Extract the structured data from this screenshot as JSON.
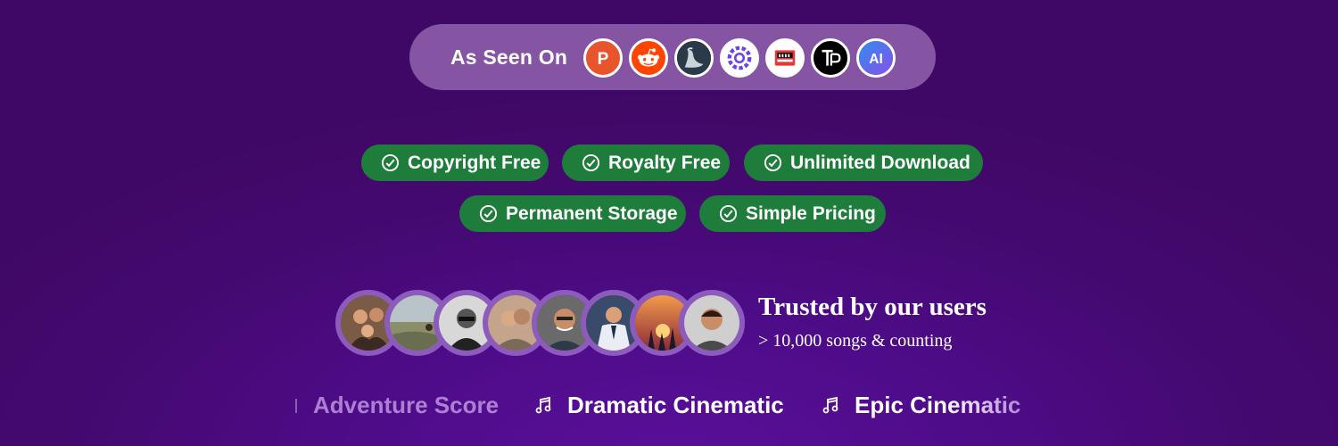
{
  "as_seen_on": {
    "label": "As Seen On",
    "logos": [
      {
        "name": "producthunt-icon",
        "letter": "P",
        "color": "#e8542c"
      },
      {
        "name": "reddit-icon",
        "color": "#ff4500"
      },
      {
        "name": "swan-icon",
        "color": "#2a3b4a"
      },
      {
        "name": "flower-icon",
        "color": "#6a45e6"
      },
      {
        "name": "marketplace-icon",
        "color": "#e53935"
      },
      {
        "name": "tp-icon",
        "letter": "TP",
        "color": "#000000"
      },
      {
        "name": "ai-icon",
        "letter": "AI",
        "color": "#3d7ae8"
      }
    ]
  },
  "features": [
    {
      "label": "Copyright Free"
    },
    {
      "label": "Royalty Free"
    },
    {
      "label": "Unlimited Download"
    },
    {
      "label": "Permanent Storage"
    },
    {
      "label": "Simple Pricing"
    }
  ],
  "trust": {
    "title": "Trusted by our users",
    "subtitle": "> 10,000 songs & counting"
  },
  "genres": [
    {
      "label": "Adventure Score"
    },
    {
      "label": "Dramatic Cinematic"
    },
    {
      "label": "Epic Cinematic"
    }
  ],
  "colors": {
    "badge_green": "#1f7d3b",
    "background_purple": "#4a0a7a",
    "pill_lavender": "#a77ec6"
  }
}
